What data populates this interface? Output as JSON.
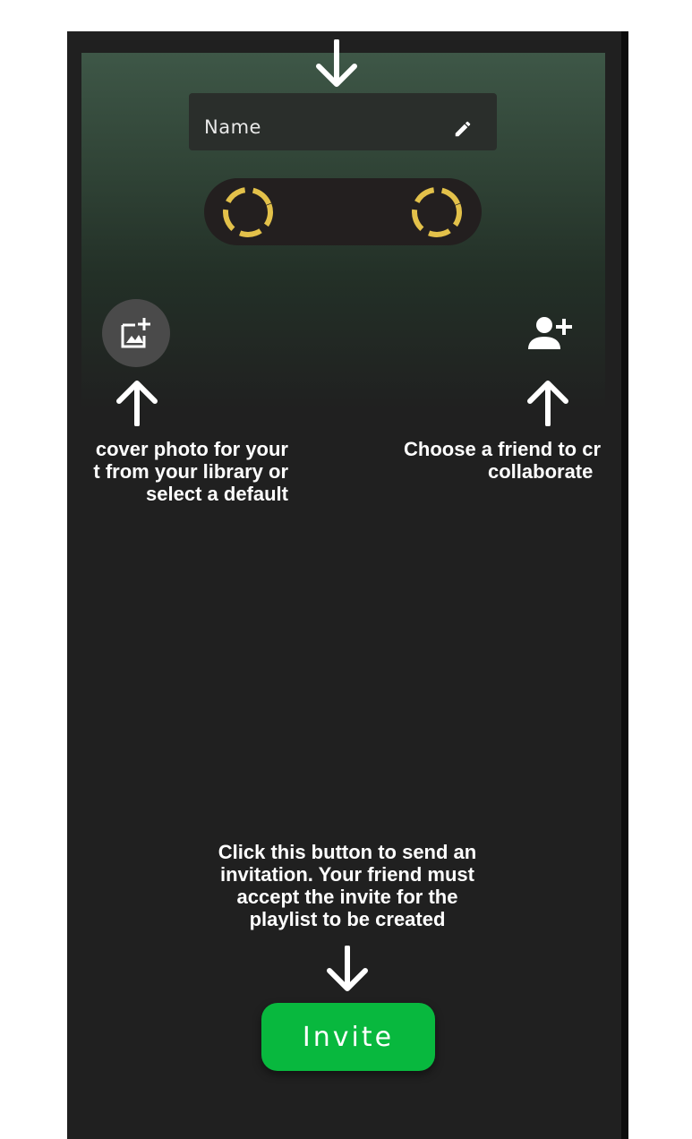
{
  "playlist_form": {
    "name_label": "Name",
    "edit_icon": "pencil-icon",
    "cassette_icon": "cassette-icon"
  },
  "cover_photo": {
    "icon": "add-photo-icon"
  },
  "collaborator": {
    "icon": "person-add-icon"
  },
  "hints": {
    "cover": {
      "line1": "cover photo for your",
      "line2": "t from your library or",
      "line3": "select a default"
    },
    "friend": {
      "line1": "Choose a friend to cr",
      "line2": "collaborate"
    },
    "invite": {
      "line1": "Click this button to send an",
      "line2": "invitation. Your friend must",
      "line3": "accept the invite for the",
      "line4": "playlist to be created"
    }
  },
  "invite_button": {
    "label": "Invite"
  },
  "colors": {
    "background": "#202020",
    "header_gradient_top": "#3e5747",
    "accent_green": "#08b83e",
    "reel_yellow": "#e3c14a"
  }
}
